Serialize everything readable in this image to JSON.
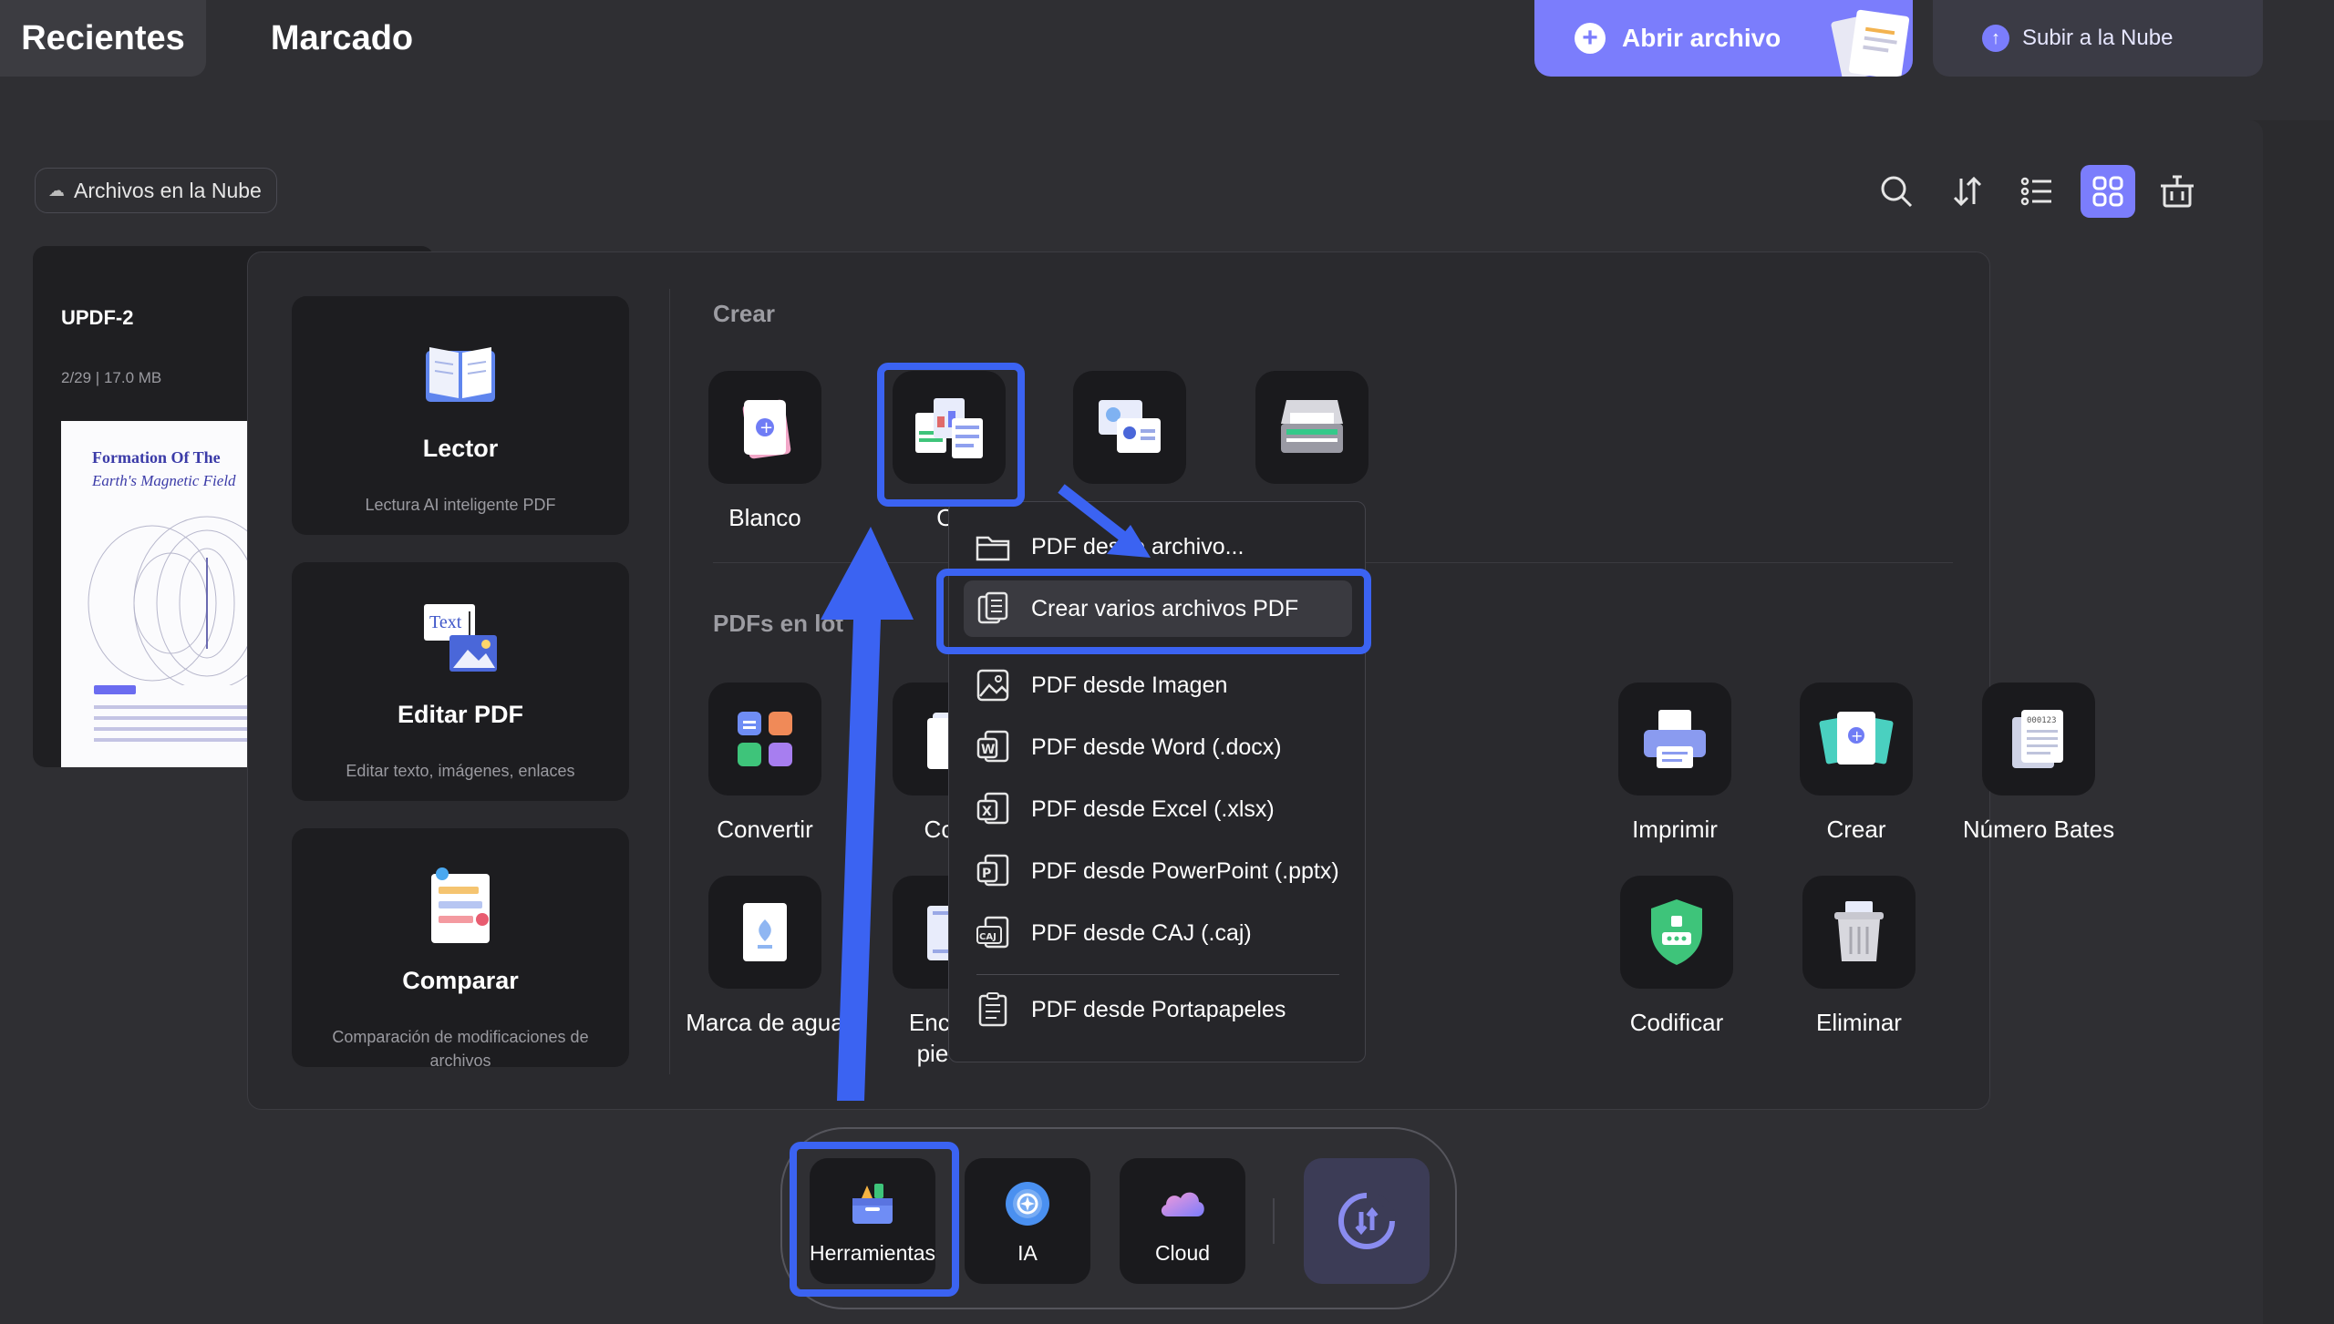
{
  "tabs": {
    "recent": "Recientes",
    "marked": "Marcado"
  },
  "header": {
    "open_file": "Abrir archivo",
    "upload_cloud": "Subir a la Nube"
  },
  "toolbar": {
    "cloud_files": "Archivos en la Nube"
  },
  "file": {
    "name": "UPDF-2",
    "meta": "2/29 | 17.0 MB",
    "thumb_title": "Formation Of The",
    "thumb_subtitle": "Earth's Magnetic Field"
  },
  "left_cards": [
    {
      "title": "Lector",
      "subtitle": "Lectura AI inteligente PDF"
    },
    {
      "title": "Editar PDF",
      "subtitle": "Editar texto, imágenes, enlaces"
    },
    {
      "title": "Comparar",
      "subtitle": "Comparación de modificaciones de archivos"
    }
  ],
  "sections": {
    "create": "Crear",
    "batch": "PDFs en lot"
  },
  "create_tools": {
    "blank": "Blanco",
    "other": "Ot"
  },
  "batch_tools": {
    "convert": "Convertir",
    "combine": "Com",
    "print": "Imprimir",
    "create": "Crear",
    "bates": "Número Bates",
    "watermark": "Marca de agua",
    "header_line1": "Encabe",
    "header_line2": "pie de",
    "encode": "Codificar",
    "delete": "Eliminar"
  },
  "menu": {
    "items": [
      "PDF desde archivo...",
      "Crear varios archivos PDF",
      "PDF desde Imagen",
      "PDF desde Word (.docx)",
      "PDF desde Excel (.xlsx)",
      "PDF desde PowerPoint (.pptx)",
      "PDF desde CAJ (.caj)",
      "PDF desde Portapapeles"
    ],
    "selected_index": 1
  },
  "dock": {
    "tools": "Herramientas",
    "ai": "IA",
    "cloud": "Cloud"
  },
  "colors": {
    "accent": "#7b7dfc",
    "highlight": "#3b63f2",
    "background": "#2b2b2e"
  }
}
